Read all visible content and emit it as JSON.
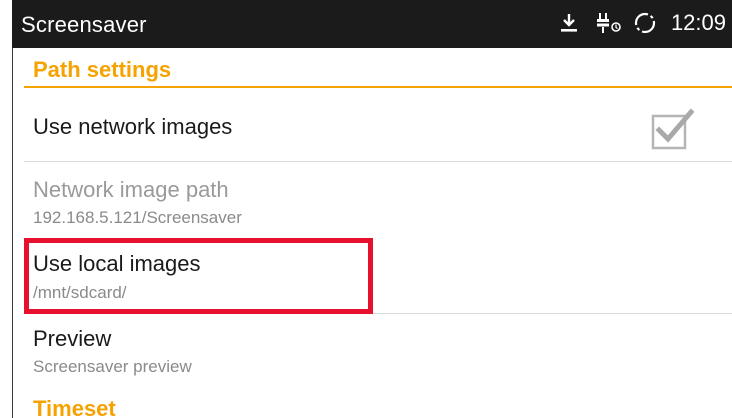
{
  "statusbar": {
    "title": "Screensaver",
    "time": "12:09",
    "icons": [
      "download-icon",
      "power-plug-icon",
      "sync-icon"
    ]
  },
  "sections": {
    "path_settings": "Path settings",
    "timeset": "Timeset"
  },
  "items": {
    "use_network_images": {
      "title": "Use network images",
      "checked": true
    },
    "network_image_path": {
      "title": "Network image path",
      "summary": "192.168.5.121/Screensaver",
      "enabled": false
    },
    "use_local_images": {
      "title": "Use local images",
      "summary": "/mnt/sdcard/"
    },
    "preview": {
      "title": "Preview",
      "summary": "Screensaver preview"
    }
  },
  "colors": {
    "accent": "#f5a300",
    "statusbar_bg": "#1b1b1b",
    "highlight": "#e8112d"
  }
}
